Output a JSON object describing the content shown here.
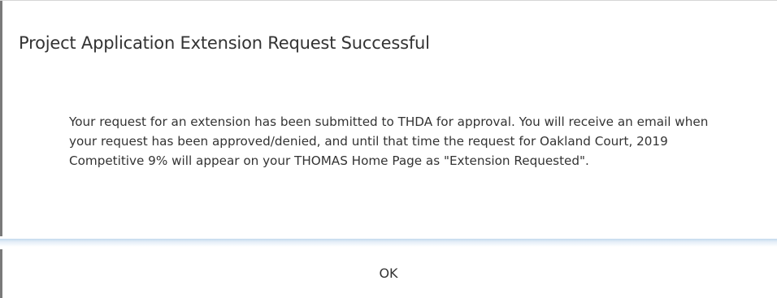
{
  "dialog": {
    "title": "Project Application Extension Request Successful",
    "message": "Your request for an extension has been submitted to THDA for approval. You will receive an email when your request has been approved/denied, and until that time the request for Oakland Court, 2019 Competitive 9% will appear on your THOMAS Home Page as \"Extension Requested\".",
    "ok_label": "OK"
  }
}
